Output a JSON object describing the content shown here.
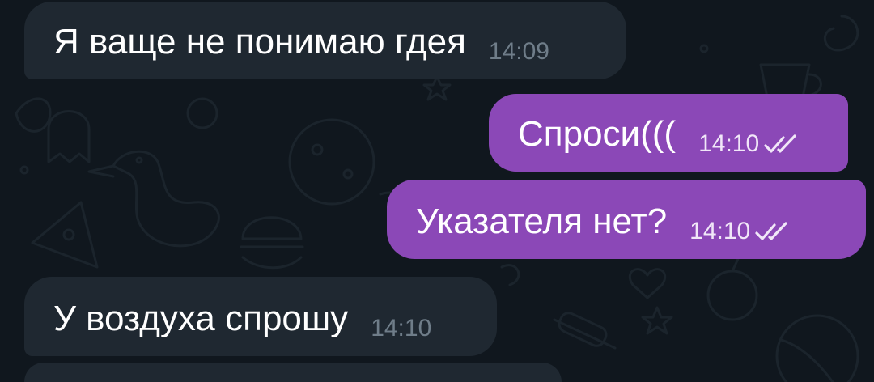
{
  "theme": {
    "background": "#10171e",
    "incoming_bubble": "#1f2831",
    "outgoing_bubble": "#8b48b7",
    "incoming_time": "#6f7d89",
    "outgoing_time": "#f1e7f8"
  },
  "messages": [
    {
      "direction": "incoming",
      "text": "Я ваще не понимаю гдея",
      "time": "14:09"
    },
    {
      "direction": "outgoing",
      "text": "Спроси(((",
      "time": "14:10",
      "status": "read-double-check-icon"
    },
    {
      "direction": "outgoing",
      "text": "Указателя нет?",
      "time": "14:10",
      "status": "read-double-check-icon"
    },
    {
      "direction": "incoming",
      "text": "У воздуха спрошу",
      "time": "14:10"
    },
    {
      "direction": "incoming",
      "text": "",
      "time": ""
    }
  ]
}
